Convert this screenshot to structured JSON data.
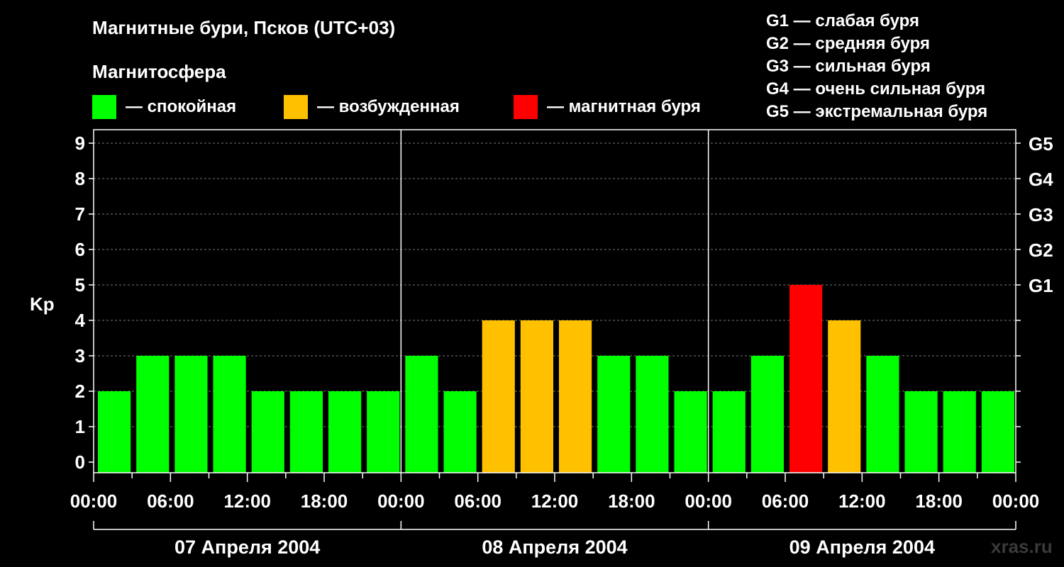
{
  "header": {
    "title": "Магнитные бури, Псков (UTC+03)",
    "subtitle": "Магнитосфера"
  },
  "legend": [
    {
      "label": "— спокойная",
      "color": "#00ff00"
    },
    {
      "label": "— возбужденная",
      "color": "#ffc000"
    },
    {
      "label": "— магнитная буря",
      "color": "#ff0000"
    }
  ],
  "g_scale": [
    "G1 — слабая буря",
    "G2 — средняя буря",
    "G3 — сильная буря",
    "G4 — очень сильная буря",
    "G5 — экстремальная буря"
  ],
  "watermark": "xras.ru",
  "chart_data": {
    "type": "bar",
    "ylabel": "Kp",
    "ylim": [
      0,
      9
    ],
    "yticks": [
      "0",
      "1",
      "2",
      "3",
      "4",
      "5",
      "6",
      "7",
      "8",
      "9"
    ],
    "right_ticks": [
      {
        "value": 5,
        "label": "G1"
      },
      {
        "value": 6,
        "label": "G2"
      },
      {
        "value": 7,
        "label": "G3"
      },
      {
        "value": 8,
        "label": "G4"
      },
      {
        "value": 9,
        "label": "G5"
      }
    ],
    "grid": "dashed horizontal",
    "x_tick_labels": [
      "00:00",
      "06:00",
      "12:00",
      "18:00",
      "00:00",
      "06:00",
      "12:00",
      "18:00",
      "00:00",
      "06:00",
      "12:00",
      "18:00",
      "00:00"
    ],
    "days": [
      "07 Апреля 2004",
      "08 Апреля 2004",
      "09 Апреля 2004"
    ],
    "interval_hours": 3,
    "values": [
      2,
      3,
      3,
      3,
      2,
      2,
      2,
      2,
      3,
      2,
      4,
      4,
      4,
      3,
      3,
      2,
      2,
      3,
      5,
      4,
      3,
      2,
      2,
      2
    ],
    "colors": {
      "quiet": "#00ff00",
      "active": "#ffc000",
      "storm": "#ff0000"
    }
  }
}
